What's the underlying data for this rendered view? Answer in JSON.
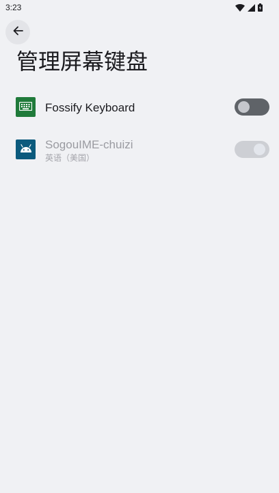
{
  "status_bar": {
    "time": "3:23",
    "icons": [
      "wifi-icon",
      "cell-signal-icon",
      "battery-icon"
    ]
  },
  "header": {
    "back_icon": "arrow-back-icon",
    "title": "管理屏幕键盘"
  },
  "keyboards": [
    {
      "name": "Fossify Keyboard",
      "subtitle": "",
      "icon": "keyboard-icon",
      "icon_color": "#1f7a3a",
      "enabled": false,
      "disabled_row": false
    },
    {
      "name": "SogouIME-chuizi",
      "subtitle": "英语（美国）",
      "icon": "android-icon",
      "icon_color": "#0b5a7d",
      "enabled": true,
      "disabled_row": true
    }
  ],
  "colors": {
    "background": "#f0f1f4",
    "toggle_off_track": "#5f6368",
    "toggle_disabled_track": "#cdcfd4"
  }
}
